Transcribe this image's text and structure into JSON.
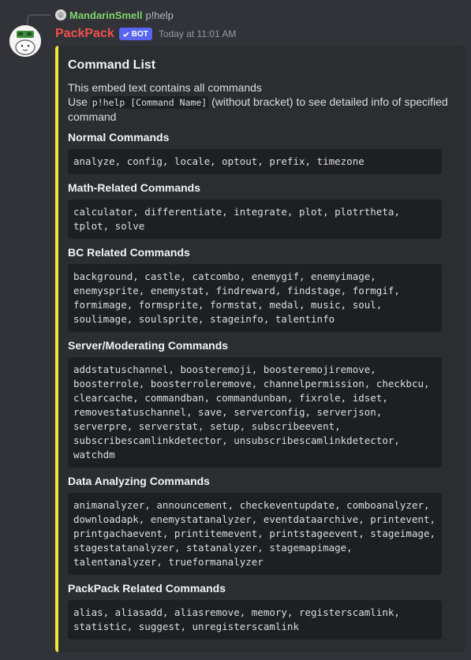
{
  "reply": {
    "username": "MandarinSmell",
    "content": "p!help"
  },
  "message": {
    "username": "PackPack",
    "bot_tag": "BOT",
    "timestamp": "Today at 11:01 AM"
  },
  "colors": {
    "embed_accent": "#f0e63c",
    "username": "#f2504a",
    "reply_username": "#7fd36f",
    "bot_tag": "#5865f2"
  },
  "embed": {
    "title": "Command List",
    "desc_line1": "This embed text contains all commands",
    "desc_use": "Use ",
    "desc_code": "p!help [Command Name]",
    "desc_rest": " (without bracket) to see detailed info of specified command",
    "fields": [
      {
        "name": "Normal Commands",
        "value": "analyze, config, locale, optout, prefix, timezone"
      },
      {
        "name": "Math-Related Commands",
        "value": "calculator, differentiate, integrate, plot, plotrtheta,\ntplot, solve"
      },
      {
        "name": "BC Related Commands",
        "value": "background, castle, catcombo, enemygif, enemyimage,\nenemysprite, enemystat, findreward, findstage, formgif,\nformimage, formsprite, formstat, medal, music, soul,\nsoulimage, soulsprite, stageinfo, talentinfo"
      },
      {
        "name": "Server/Moderating Commands",
        "value": "addstatuschannel, boosteremoji, boosteremojiremove,\nboosterrole, boosterroleremove, channelpermission, checkbcu,\nclearcache, commandban, commandunban, fixrole, idset,\nremovestatuschannel, save, serverconfig, serverjson,\nserverpre, serverstat, setup, subscribeevent,\nsubscribescamlinkdetector, unsubscribescamlinkdetector,\nwatchdm"
      },
      {
        "name": "Data Analyzing Commands",
        "value": "animanalyzer, announcement, checkeventupdate, comboanalyzer,\ndownloadapk, enemystatanalyzer, eventdataarchive, printevent,\nprintgachaevent, printitemevent, printstageevent, stageimage,\nstagestatanalyzer, statanalyzer, stagemapimage,\ntalentanalyzer, trueformanalyzer"
      },
      {
        "name": "PackPack Related Commands",
        "value": "alias, aliasadd, aliasremove, memory, registerscamlink,\nstatistic, suggest, unregisterscamlink"
      }
    ]
  }
}
